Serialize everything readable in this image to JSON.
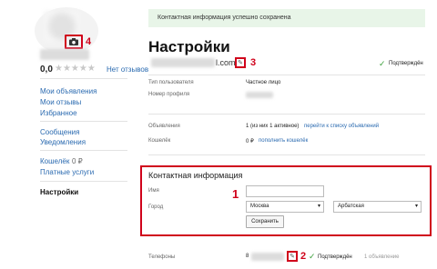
{
  "sidebar": {
    "rating": "0,0",
    "stars": "★★★★★",
    "no_reviews": "Нет отзывов",
    "nav1": [
      "Мои объявления",
      "Мои отзывы",
      "Избранное"
    ],
    "nav2": [
      "Сообщения",
      "Уведомления"
    ],
    "wallet": "Кошелёк",
    "wallet_amount": "0 ₽",
    "paid": "Платные услуги",
    "settings": "Настройки"
  },
  "markers": {
    "one": "1",
    "two": "2",
    "three": "3",
    "four": "4"
  },
  "alert": "Контактная информация успешно сохранена",
  "page_title": "Настройки",
  "email_suffix": "l.com",
  "confirmed": "Подтверждён",
  "rows": {
    "user_type_label": "Тип пользователя",
    "user_type_value": "Частное лицо",
    "profile_label": "Номер профиля",
    "ads_label": "Объявления",
    "ads_value": "1 (из них 1 активное)",
    "ads_link": "перейти к списку объявлений",
    "wallet_label": "Кошелёк",
    "wallet_value": "0 ₽",
    "wallet_link": "пополнить кошелёк"
  },
  "contact": {
    "title": "Контактная информация",
    "name_label": "Имя",
    "city_label": "Город",
    "city_value": "Москва",
    "district_value": "Арбатская",
    "save_button": "Сохранить"
  },
  "phones": {
    "label": "Телефоны",
    "prefix": "8",
    "confirmed": "Подтверждён",
    "ads_count": "1 объявление"
  },
  "colors": {
    "accent_red": "#d0021b",
    "link": "#2a6ab0",
    "success_bg": "#e8f5e8"
  }
}
